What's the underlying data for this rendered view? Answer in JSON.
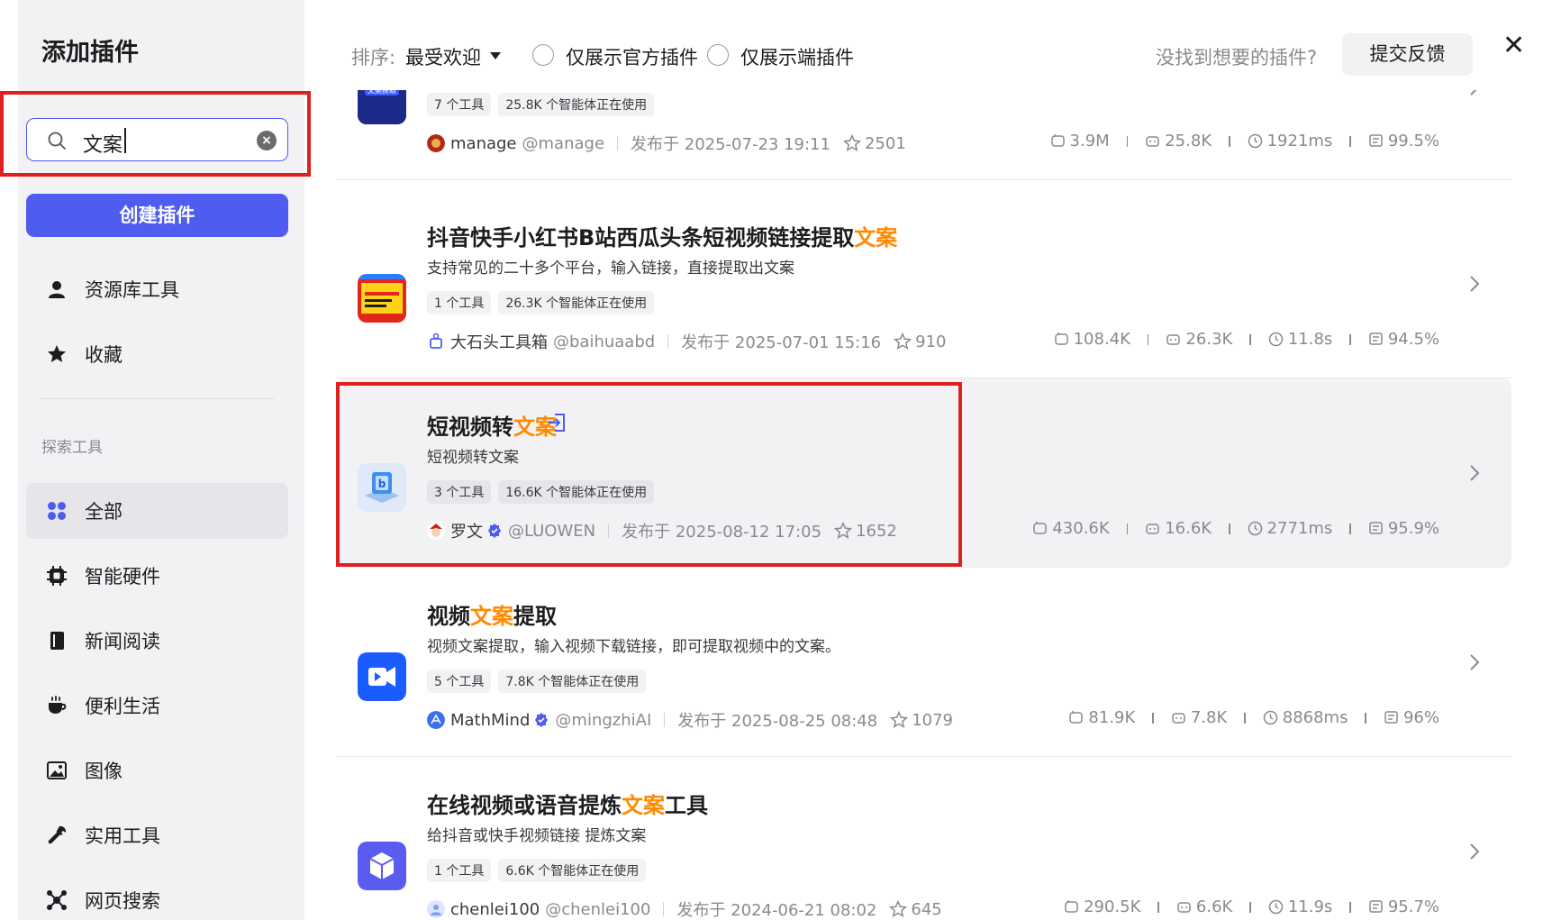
{
  "sidebar": {
    "title": "添加插件",
    "search": {
      "value": "文案",
      "clear_icon": "close-circle-icon"
    },
    "create_button": "创建插件",
    "items": [
      {
        "label": "资源库工具",
        "icon": "user-icon"
      },
      {
        "label": "收藏",
        "icon": "star-icon"
      }
    ],
    "section_label": "探索工具",
    "categories": [
      {
        "label": "全部",
        "icon": "grid-icon",
        "active": true
      },
      {
        "label": "智能硬件",
        "icon": "chip-icon"
      },
      {
        "label": "新闻阅读",
        "icon": "book-icon"
      },
      {
        "label": "便利生活",
        "icon": "cup-icon"
      },
      {
        "label": "图像",
        "icon": "image-icon"
      },
      {
        "label": "实用工具",
        "icon": "wrench-icon"
      },
      {
        "label": "网页搜索",
        "icon": "network-icon"
      }
    ]
  },
  "header": {
    "sort_label": "排序:",
    "sort_value": "最受欢迎",
    "filter_official": "仅展示官方插件",
    "filter_device": "仅展示端插件",
    "feedback_question": "没找到想要的插件?",
    "feedback_button": "提交反馈",
    "close_icon": "close-icon"
  },
  "highlight_color": "#ff8a00",
  "accent_color": "#4e5cf0",
  "plugins": [
    {
      "title_pre": "",
      "title_hl": "",
      "title_post": "",
      "description": "",
      "tools": "7 个工具",
      "users": "25.8K 个智能体正在使用",
      "author": "manage",
      "handle": "@manage",
      "verified": false,
      "published": "发布于 2025-07-23 19:11",
      "stars": "2501",
      "stats": [
        "3.9M",
        "25.8K",
        "1921ms",
        "99.5%"
      ]
    },
    {
      "title_pre": "抖音快手小红书B站西瓜头条短视频链接提取",
      "title_hl": "文案",
      "title_post": "",
      "description": "支持常见的二十多个平台，输入链接，直接提取出文案",
      "tools": "1 个工具",
      "users": "26.3K 个智能体正在使用",
      "author": "大石头工具箱",
      "handle": "@baihuaabd",
      "verified": false,
      "published": "发布于 2025-07-01 15:16",
      "stars": "910",
      "stats": [
        "108.4K",
        "26.3K",
        "11.8s",
        "94.5%"
      ]
    },
    {
      "title_pre": "短视频转",
      "title_hl": "文案",
      "title_post": "",
      "description": "短视频转文案",
      "tools": "3 个工具",
      "users": "16.6K 个智能体正在使用",
      "author": "罗文",
      "handle": "@LUOWEN",
      "verified": true,
      "published": "发布于 2025-08-12 17:05",
      "stars": "1652",
      "stats": [
        "430.6K",
        "16.6K",
        "2771ms",
        "95.9%"
      ]
    },
    {
      "title_pre": "视频",
      "title_hl": "文案",
      "title_post": "提取",
      "description": "视频文案提取，输入视频下载链接，即可提取视频中的文案。",
      "tools": "5 个工具",
      "users": "7.8K 个智能体正在使用",
      "author": "MathMind",
      "handle": "@mingzhiAI",
      "verified": true,
      "published": "发布于 2025-08-25 08:48",
      "stars": "1079",
      "stats": [
        "81.9K",
        "7.8K",
        "8868ms",
        "96%"
      ]
    },
    {
      "title_pre": "在线视频或语音提炼",
      "title_hl": "文案",
      "title_post": "工具",
      "description": "给抖音或快手视频链接 提炼文案",
      "tools": "1 个工具",
      "users": "6.6K 个智能体正在使用",
      "author": "chenlei100",
      "handle": "@chenlei100",
      "verified": false,
      "published": "发布于 2024-06-21 08:02",
      "stars": "645",
      "stats": [
        "290.5K",
        "6.6K",
        "11.9s",
        "95.7%"
      ]
    }
  ]
}
